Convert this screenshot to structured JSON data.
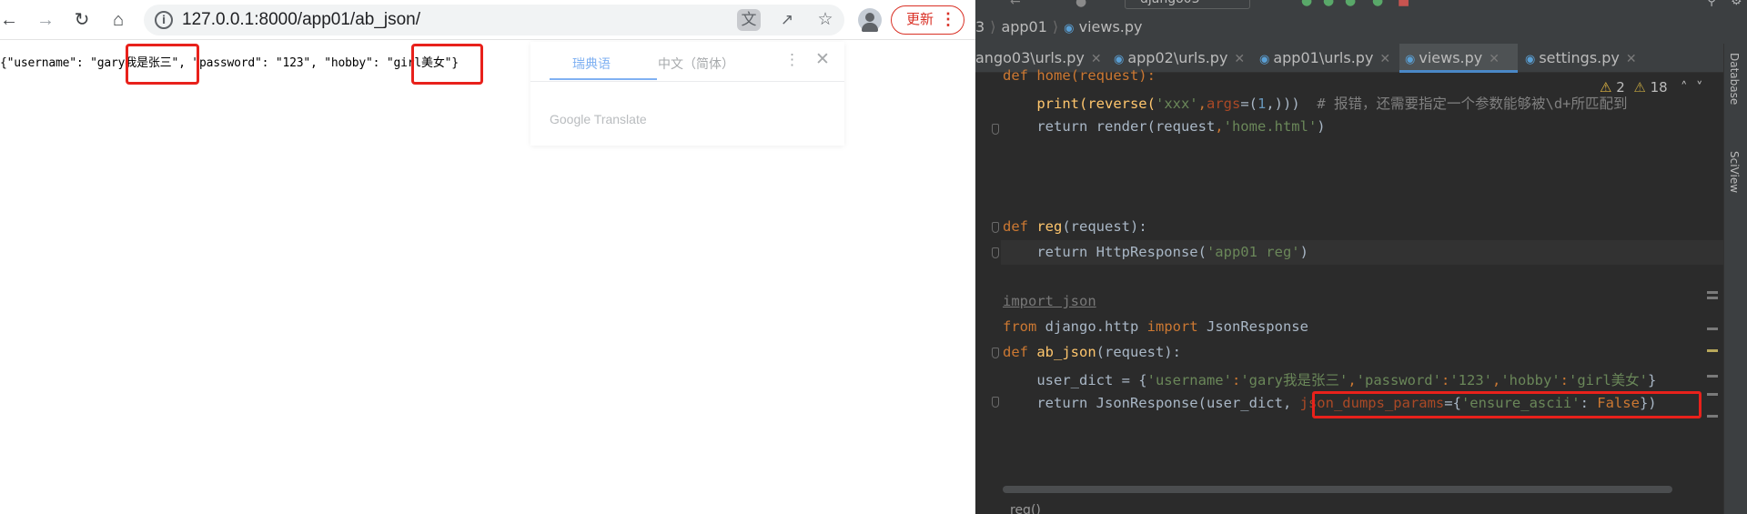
{
  "browser": {
    "url_host": "127.0.0.1",
    "url_path": ":8000/app01/ab_json/",
    "update_label": "更新",
    "response_text": "{\"username\": \"gary我是张三\", \"password\": \"123\", \"hobby\": \"girl美女\"}",
    "translate_popup": {
      "tab_source": "瑞典语",
      "tab_target": "中文（简体）",
      "brand": "Google Translate"
    }
  },
  "ide": {
    "breadcrumb_root": "3",
    "breadcrumb_folder": "app01",
    "breadcrumb_file": "views.py",
    "project_name": "django03",
    "tabs": [
      {
        "label": "ango03\\urls.py",
        "active": false
      },
      {
        "label": "app02\\urls.py",
        "active": false
      },
      {
        "label": "app01\\urls.py",
        "active": false
      },
      {
        "label": "views.py",
        "active": true
      },
      {
        "label": "settings.py",
        "active": false
      }
    ],
    "warnings_count": "2",
    "weak_warnings_count": "18",
    "side_tools": [
      "Database",
      "SciView"
    ],
    "bottom_breadcrumb": "reg()",
    "code": {
      "l1": "def home(request):",
      "l2a": "    print(reverse(",
      "l2b": "'xxx'",
      "l2c": ",",
      "l2d": "args",
      "l2e": "=(",
      "l2f": "1",
      "l2g": ",)))  ",
      "l2h": "# 报错，还需要指定一个参数能够被\\d+所匹配到",
      "l3a": "    return render(request",
      "l3b": ",",
      "l3c": "'home.html'",
      "l3d": ")",
      "l4a": "def ",
      "l4b": "reg",
      "l4c": "(request):",
      "l5a": "    return HttpResponse(",
      "l5b": "'app01 reg'",
      "l5c": ")",
      "l6": "import json",
      "l7a": "from",
      "l7b": " django.http ",
      "l7c": "import",
      "l7d": " JsonResponse",
      "l8a": "def ",
      "l8b": "ab_json",
      "l8c": "(request):",
      "l9a": "    user_dict = {",
      "l9b": "'username'",
      "l9c": ":",
      "l9d": "'gary我是张三'",
      "l9e": ",",
      "l9f": "'password'",
      "l9g": ":",
      "l9h": "'123'",
      "l9i": ",",
      "l9j": "'hobby'",
      "l9k": ":",
      "l9l": "'girl美女'",
      "l9m": "}",
      "l10a": "    return JsonResponse(user_dict, ",
      "l10b": "json_dumps_params",
      "l10c": "={",
      "l10d": "'ensure_ascii'",
      "l10e": ": ",
      "l10f": "False",
      "l10g": "})"
    }
  },
  "colors": {
    "highlight_box": "#e8211b",
    "ide_background": "#2b2b2b",
    "keyword": "#cc7832",
    "string": "#6a8759",
    "function": "#ffc66d"
  }
}
